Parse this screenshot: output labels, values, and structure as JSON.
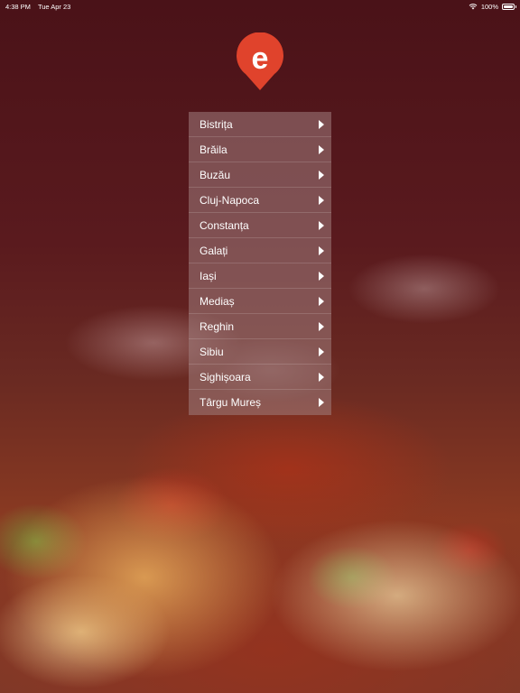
{
  "status_bar": {
    "time": "4:38 PM",
    "date": "Tue Apr 23",
    "battery": "100%"
  },
  "logo": {
    "letter": "e",
    "color": "#e0432c"
  },
  "cities": [
    {
      "label": "Bistrița"
    },
    {
      "label": "Brăila"
    },
    {
      "label": "Buzău"
    },
    {
      "label": "Cluj-Napoca"
    },
    {
      "label": "Constanța"
    },
    {
      "label": "Galați"
    },
    {
      "label": "Iași"
    },
    {
      "label": "Mediaș"
    },
    {
      "label": "Reghin"
    },
    {
      "label": "Sibiu"
    },
    {
      "label": "Sighișoara"
    },
    {
      "label": "Târgu Mureș"
    }
  ],
  "icons": {
    "row_arrow": "chevron-right-icon"
  }
}
